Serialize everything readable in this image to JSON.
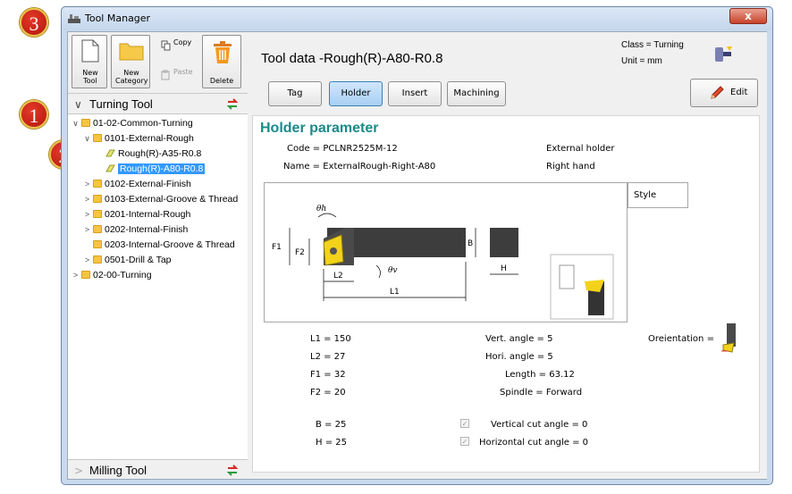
{
  "window": {
    "title": "Tool Manager",
    "close_label": "x"
  },
  "badges": [
    "1",
    "2",
    "3"
  ],
  "toolbar": {
    "new_tool": "New Tool",
    "new_category": "New Category",
    "copy": "Copy",
    "paste": "Paste",
    "delete": "Delete"
  },
  "sidebar": {
    "turning_tool": "Turning Tool",
    "milling_tool": "Milling Tool",
    "tree": [
      {
        "label": "01-02-Common-Turning",
        "level": 0,
        "expanded": true,
        "type": "folder"
      },
      {
        "label": "0101-External-Rough",
        "level": 1,
        "expanded": true,
        "type": "folder"
      },
      {
        "label": "Rough(R)-A35-R0.8",
        "level": 2,
        "type": "tool"
      },
      {
        "label": "Rough(R)-A80-R0.8",
        "level": 2,
        "type": "tool",
        "selected": true
      },
      {
        "label": "0102-External-Finish",
        "level": 1,
        "expanded": false,
        "type": "folder"
      },
      {
        "label": "0103-External-Groove & Thread",
        "level": 1,
        "expanded": false,
        "type": "folder"
      },
      {
        "label": "0201-Internal-Rough",
        "level": 1,
        "expanded": false,
        "type": "folder"
      },
      {
        "label": "0202-Internal-Finish",
        "level": 1,
        "expanded": false,
        "type": "folder"
      },
      {
        "label": "0203-Internal-Groove & Thread",
        "level": 1,
        "type": "folder"
      },
      {
        "label": "0501-Drill & Tap",
        "level": 1,
        "expanded": false,
        "type": "folder"
      },
      {
        "label": "02-00-Turning",
        "level": 0,
        "expanded": false,
        "type": "folder"
      }
    ]
  },
  "header": {
    "title": "Tool data -Rough(R)-A80-R0.8",
    "class": "Class = Turning",
    "unit": "Unit = mm"
  },
  "tabs": [
    {
      "label": "Tag",
      "active": false
    },
    {
      "label": "Holder",
      "active": true
    },
    {
      "label": "Insert",
      "active": false
    },
    {
      "label": "Machining",
      "active": false
    }
  ],
  "edit_label": "Edit",
  "holder": {
    "section_title": "Holder parameter",
    "code": "Code = PCLNR2525M-12",
    "name": "Name = ExternalRough-Right-A80",
    "holder_type": "External holder",
    "hand": "Right hand",
    "style_label": "Style",
    "drawing_labels": {
      "theta_h": "θh",
      "theta_v": "θv",
      "F1": "F1",
      "F2": "F2",
      "L1": "L1",
      "L2": "L2",
      "B": "B",
      "H": "H"
    },
    "params": {
      "L1": "L1 = 150",
      "L2": "L2 = 27",
      "F1": "F1 = 32",
      "F2": "F2 = 20",
      "B": "B = 25",
      "H": "H = 25",
      "vert_angle": "Vert. angle = 5",
      "hori_angle": "Hori. angle = 5",
      "length": "Length = 63.12",
      "spindle": "Spindle = Forward",
      "vertical_cut": "Vertical cut angle = 0",
      "horizontal_cut": "Horizontal cut angle = 0",
      "orientation": "Oreientation ="
    }
  }
}
